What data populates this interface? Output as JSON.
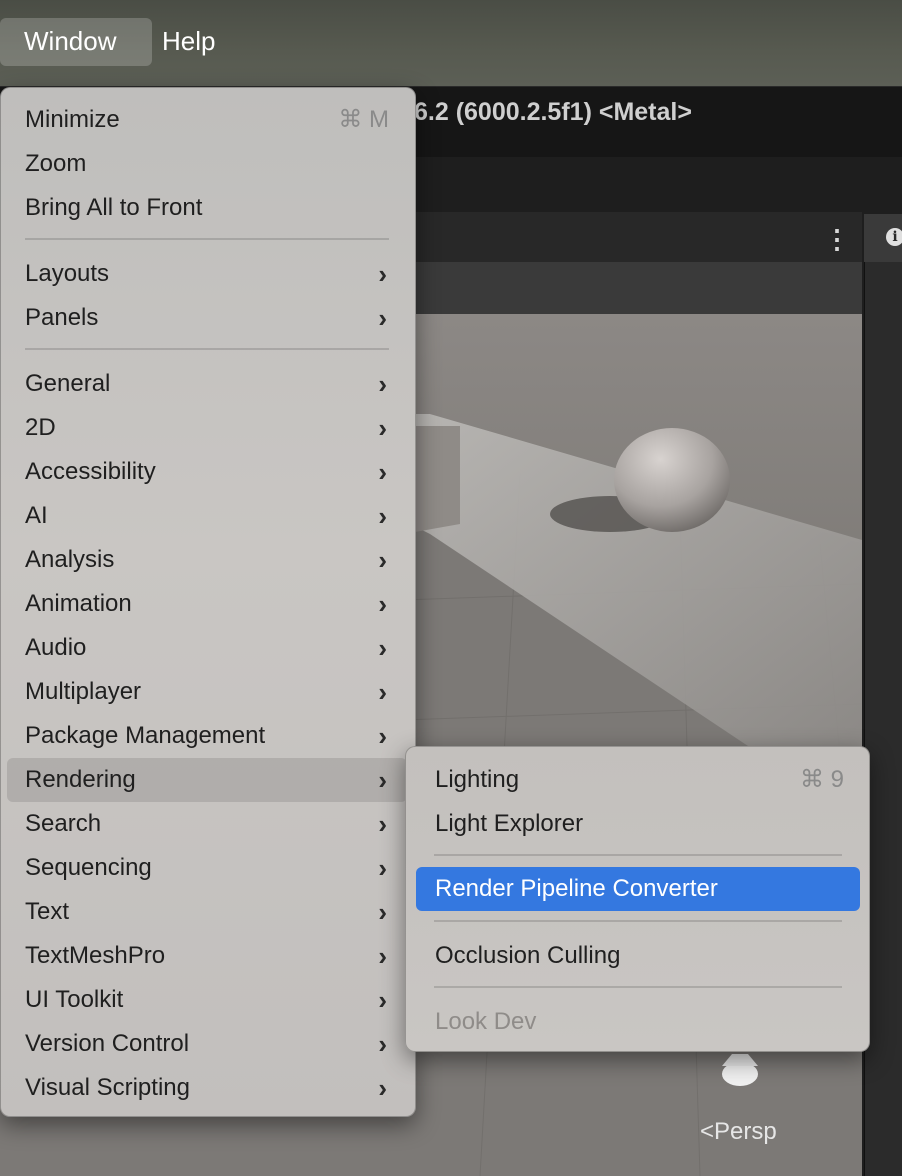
{
  "menubar": {
    "window_label": "Window",
    "help_label": "Help"
  },
  "editor": {
    "title": "6.2 (6000.2.5f1) <Metal>",
    "persp_label": "Persp",
    "more_icon": "kebab-vertical-icon",
    "info_icon": "info-icon"
  },
  "window_menu": {
    "items": [
      {
        "label": "Minimize",
        "shortcut": "⌘ M"
      },
      {
        "label": "Zoom"
      },
      {
        "label": "Bring All to Front"
      },
      {
        "label": "Layouts",
        "submenu": true
      },
      {
        "label": "Panels",
        "submenu": true
      },
      {
        "label": "General",
        "submenu": true
      },
      {
        "label": "2D",
        "submenu": true
      },
      {
        "label": "Accessibility",
        "submenu": true
      },
      {
        "label": "AI",
        "submenu": true
      },
      {
        "label": "Analysis",
        "submenu": true
      },
      {
        "label": "Animation",
        "submenu": true
      },
      {
        "label": "Audio",
        "submenu": true
      },
      {
        "label": "Multiplayer",
        "submenu": true
      },
      {
        "label": "Package Management",
        "submenu": true
      },
      {
        "label": "Rendering",
        "submenu": true,
        "highlighted": true
      },
      {
        "label": "Search",
        "submenu": true
      },
      {
        "label": "Sequencing",
        "submenu": true
      },
      {
        "label": "Text",
        "submenu": true
      },
      {
        "label": "TextMeshPro",
        "submenu": true
      },
      {
        "label": "UI Toolkit",
        "submenu": true
      },
      {
        "label": "Version Control",
        "submenu": true
      },
      {
        "label": "Visual Scripting",
        "submenu": true
      }
    ]
  },
  "rendering_submenu": {
    "items": [
      {
        "label": "Lighting",
        "shortcut": "⌘ 9"
      },
      {
        "label": "Light Explorer"
      },
      {
        "label": "Render Pipeline Converter",
        "selected": true
      },
      {
        "label": "Occlusion Culling"
      },
      {
        "label": "Look Dev",
        "disabled": true
      }
    ]
  },
  "colors": {
    "selection_blue": "#3478e0",
    "menu_bg": "#c9c6c3"
  }
}
